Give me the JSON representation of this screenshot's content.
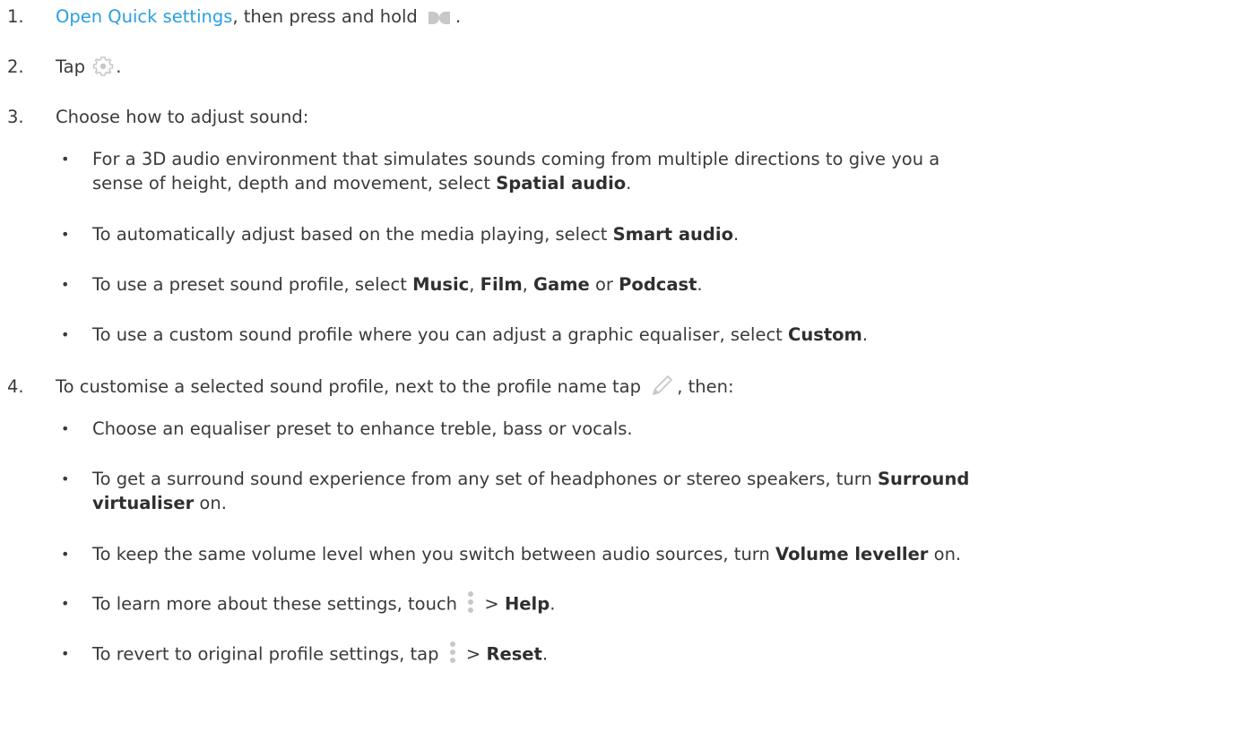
{
  "steps": [
    {
      "number": "1.",
      "link": "Open Quick settings",
      "after_link": ", then press and hold ",
      "after_icon": ".",
      "icon": "dolby-icon"
    },
    {
      "number": "2.",
      "before_icon": "Tap ",
      "after_icon": ".",
      "icon": "gear-icon"
    },
    {
      "number": "3.",
      "text": "Choose how to adjust sound:",
      "bullets": [
        {
          "line1": "For a 3D audio environment that simulates sounds coming from multiple directions to give you a",
          "line2_pre": "sense of height, depth and movement, select ",
          "bold": "Spatial audio",
          "post": "."
        },
        {
          "pre": "To automatically adjust based on the media playing, select ",
          "bold": "Smart audio",
          "post": "."
        },
        {
          "pre": "To use a preset sound profile, select ",
          "bold1": "Music",
          "sep1": ", ",
          "bold2": "Film",
          "sep2": ", ",
          "bold3": "Game",
          "sep3": " or ",
          "bold4": "Podcast",
          "post": "."
        },
        {
          "pre": "To use a custom sound profile where you can adjust a graphic equaliser, select ",
          "bold": "Custom",
          "post": "."
        }
      ]
    },
    {
      "number": "4.",
      "before_icon": "To customise a selected sound profile, next to the profile name tap ",
      "after_icon": ", then:",
      "icon": "pencil-icon",
      "bullets": [
        {
          "text": "Choose an equaliser preset to enhance treble, bass or vocals."
        },
        {
          "line1_pre": "To get a surround sound experience from any set of headphones or stereo speakers, turn ",
          "bold_a": "Surround",
          "bold_b": "virtualiser",
          "post": " on."
        },
        {
          "pre": "To keep the same volume level when you switch between audio sources, turn ",
          "bold": "Volume leveller",
          "post": " on."
        },
        {
          "pre": "To learn more about these settings, touch ",
          "mid": " > ",
          "bold": "Help",
          "post": ".",
          "icon": "more-vert-icon"
        },
        {
          "pre": "To revert to original profile settings, tap ",
          "mid": " > ",
          "bold": "Reset",
          "post": ".",
          "icon": "more-vert-icon"
        }
      ]
    }
  ],
  "bullet_char": "•",
  "colors": {
    "text": "#3a3a3a",
    "link": "#2aa0e0",
    "icon_grey": "#c8c8c8"
  }
}
